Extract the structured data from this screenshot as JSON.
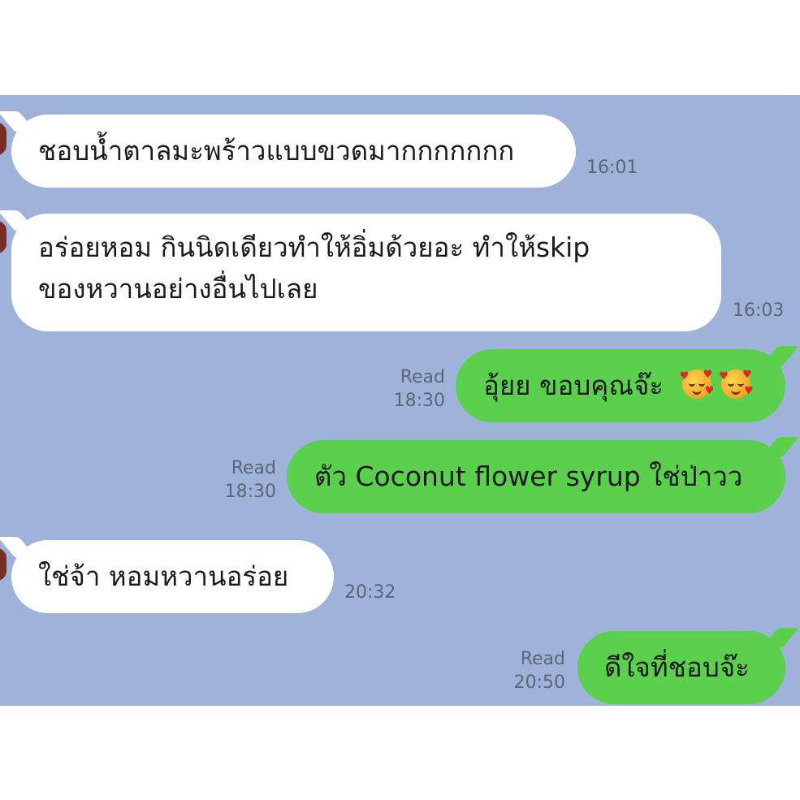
{
  "messages": [
    {
      "side": "in",
      "text": "ชอบน้ำตาลมะพร้าวแบบขวดมากกกกกกก",
      "time": "16:01"
    },
    {
      "side": "in",
      "lines": [
        "อร่อยหอม กินนิดเดียวทำให้อิ่มด้วยอะ ทำให้skip",
        "ของหวานอย่างอื่นไปเลย"
      ],
      "time": "16:03"
    },
    {
      "side": "out",
      "text": "อุ้ยย ขอบคุณจ๊ะ",
      "read": "Read",
      "time": "18:30",
      "emoji": [
        "smiling-face-with-hearts",
        "smiling-face-with-hearts"
      ]
    },
    {
      "side": "out",
      "text": "ตัว Coconut flower syrup ใช่ป่าวว",
      "read": "Read",
      "time": "18:30"
    },
    {
      "side": "in",
      "text": "ใช่จ้า หอมหวานอร่อย",
      "time": "20:32"
    },
    {
      "side": "out",
      "text": "ดีใจที่ชอบจ๊ะ",
      "read": "Read",
      "time": "20:50"
    }
  ],
  "colors": {
    "chat_background": "#9fb2da",
    "incoming_bubble": "#ffffff",
    "outgoing_bubble": "#5ad04c",
    "meta_text": "#5c6675"
  }
}
